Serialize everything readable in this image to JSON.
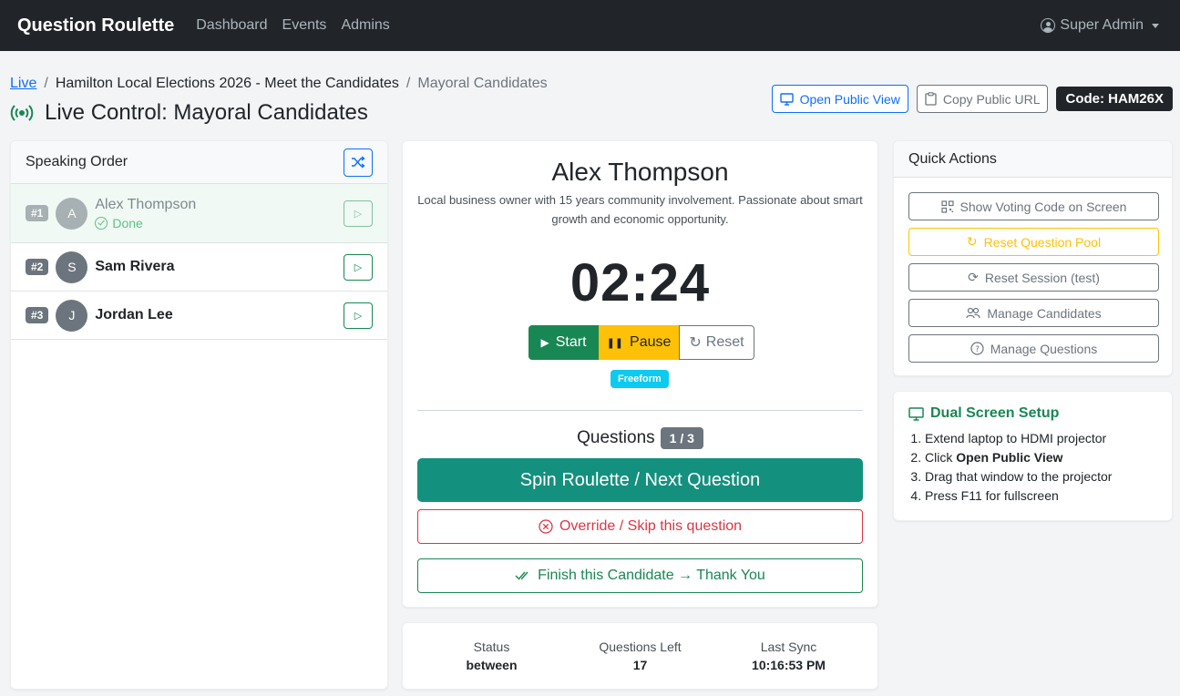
{
  "nav": {
    "brand": "Question Roulette",
    "links": [
      "Dashboard",
      "Events",
      "Admins"
    ],
    "user": "Super Admin"
  },
  "breadcrumb": {
    "root": "Live",
    "event": "Hamilton Local Elections 2026 - Meet the Candidates",
    "current": "Mayoral Candidates"
  },
  "page_title": "Live Control: Mayoral Candidates",
  "header_actions": {
    "open_public": "Open Public View",
    "copy_url": "Copy Public URL",
    "code": "Code: HAM26X"
  },
  "speaking_order": {
    "title": "Speaking Order",
    "items": [
      {
        "num": "#1",
        "initial": "A",
        "name": "Alex Thompson",
        "status": "Done"
      },
      {
        "num": "#2",
        "initial": "S",
        "name": "Sam Rivera"
      },
      {
        "num": "#3",
        "initial": "J",
        "name": "Jordan Lee"
      }
    ]
  },
  "current": {
    "name": "Alex Thompson",
    "bio": "Local business owner with 15 years community involvement. Passionate about smart growth and economic opportunity.",
    "timer": "02:24",
    "start": "Start",
    "pause": "Pause",
    "reset": "Reset",
    "mode": "Freeform",
    "questions_label": "Questions",
    "questions_count": "1 / 3",
    "spin": "Spin Roulette / Next Question",
    "skip": "Override / Skip this question",
    "finish": "Finish this Candidate → Thank You"
  },
  "status": {
    "status_label": "Status",
    "status_value": "between",
    "left_label": "Questions Left",
    "left_value": "17",
    "sync_label": "Last Sync",
    "sync_value": "10:16:53 PM"
  },
  "quick_actions": {
    "title": "Quick Actions",
    "voting_code": "Show Voting Code on Screen",
    "reset_pool": "Reset Question Pool",
    "reset_session": "Reset Session (test)",
    "manage_candidates": "Manage Candidates",
    "manage_questions": "Manage Questions"
  },
  "dual_screen": {
    "title": "Dual Screen Setup",
    "step1": "Extend laptop to HDMI projector",
    "step2_pre": "Click ",
    "step2_bold": "Open Public View",
    "step3": "Drag that window to the projector",
    "step4": "Press F11 for fullscreen"
  },
  "colors": {
    "primary": "#0d6efd",
    "success": "#198754",
    "warning": "#ffc107",
    "danger": "#dc3545",
    "spin": "#14907e",
    "info": "#0dcaf0"
  }
}
